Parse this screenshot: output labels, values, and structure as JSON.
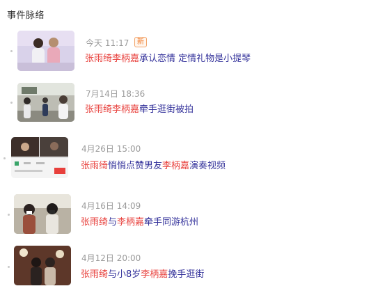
{
  "header": {
    "title": "事件脉络"
  },
  "colors": {
    "accent_red": "#e8403c",
    "link_blue": "#32309a",
    "badge_orange": "#f07a2a"
  },
  "events": [
    {
      "date": "今天 11:17",
      "badge": "新",
      "title_parts": [
        "张雨绮",
        "李柄嘉",
        "承认恋情 定情礼物是小提琴"
      ]
    },
    {
      "date": "7月14日 18:36",
      "title_parts": [
        "张雨绮",
        "李柄嘉",
        "牵手逛街被拍"
      ]
    },
    {
      "date": "4月26日 15:00",
      "title_parts": [
        "张雨绮",
        "悄悄点赞男友",
        "李柄嘉",
        "演奏视频"
      ]
    },
    {
      "date": "4月16日 14:09",
      "title_parts": [
        "张雨绮",
        "与",
        "李柄嘉",
        "牵手同游杭州"
      ]
    },
    {
      "date": "4月12日 20:00",
      "title_parts": [
        "张雨绮",
        "与小8岁",
        "李柄嘉",
        "挽手逛街"
      ]
    }
  ]
}
